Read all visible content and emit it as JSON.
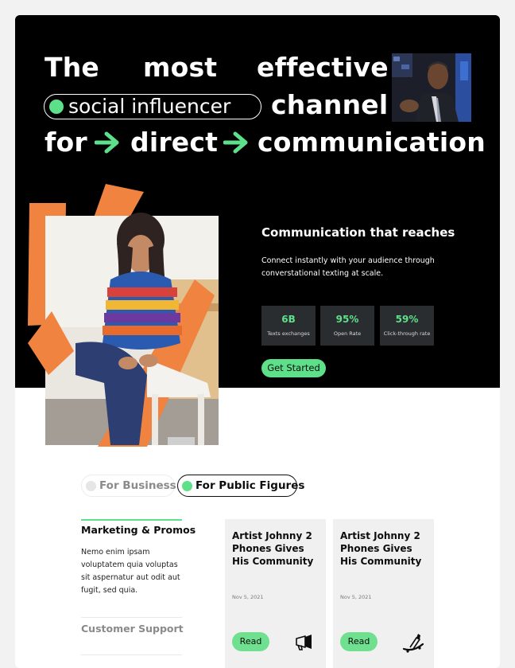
{
  "headline": {
    "word_the": "The",
    "word_most": "most",
    "word_effective": "effective",
    "pill_text": "social influencer",
    "word_channel": "channel",
    "word_for": "for",
    "word_direct": "direct",
    "word_communication": "communication"
  },
  "section": {
    "title": "Communication that reaches",
    "description": "Connect instantly with your audience through converstational texting at scale."
  },
  "stats": [
    {
      "value": "6B",
      "label": "Texts exchanges"
    },
    {
      "value": "95%",
      "label": "Open Rate"
    },
    {
      "value": "59%",
      "label": "Click-through rate"
    }
  ],
  "cta_label": "Get Started",
  "tabs": [
    {
      "label": "For Business",
      "active": false
    },
    {
      "label": "For Public Figures",
      "active": true
    }
  ],
  "categories": {
    "active_title": "Marketing & Promos",
    "active_text": "Nemo enim ipsam voluptatem quia voluptas sit aspernatur aut odit aut fugit, sed quia.",
    "second_title": "Customer Support"
  },
  "cards": [
    {
      "title": "Artist Johnny 2 Phones Gives His Community",
      "date": "Nov 5, 2021",
      "button": "Read",
      "icon": "megaphone-icon"
    },
    {
      "title": "Artist Johnny 2 Phones Gives His Community",
      "date": "Nov 5, 2021",
      "button": "Read",
      "icon": "skateboard-icon"
    }
  ],
  "colors": {
    "accent": "#5ee08a",
    "hero_bg": "#000000",
    "shape_orange": "#f0833f",
    "stat_bg": "#2a2d30",
    "card_bg": "#f0f0f0"
  }
}
